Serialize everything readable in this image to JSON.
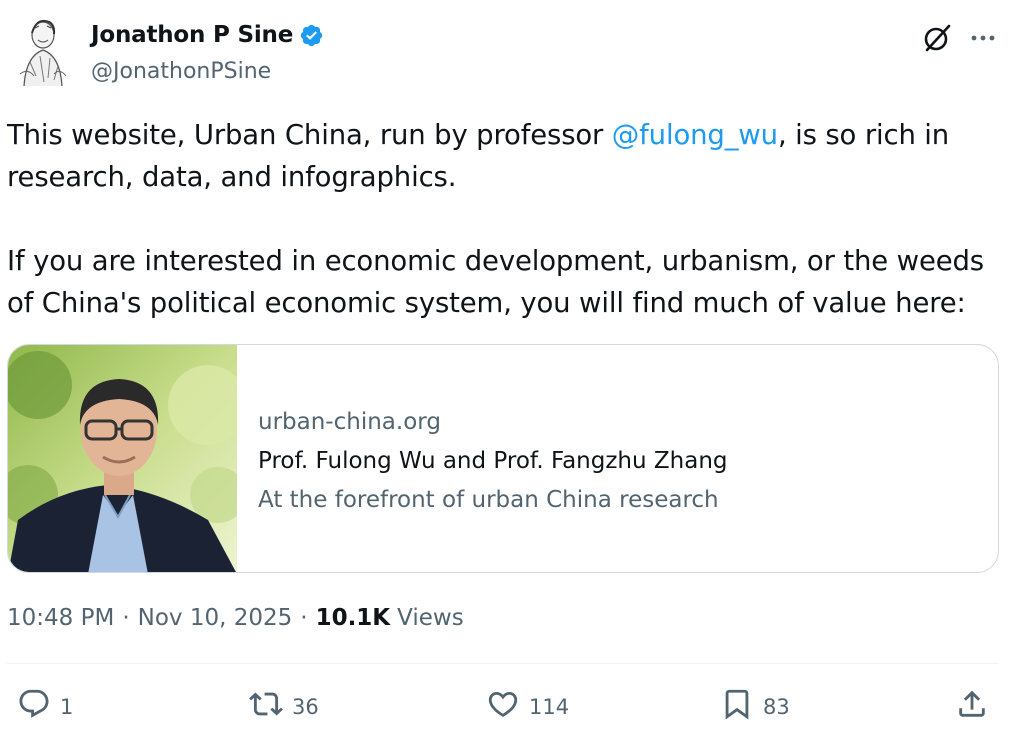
{
  "author": {
    "name": "Jonathon P Sine",
    "handle": "@JonathonPSine",
    "verified_icon": "verified-badge-icon",
    "avatar": "sketch-portrait-avatar"
  },
  "tweet": {
    "para1_before": "This website, Urban China, run by professor ",
    "mention": "@fulong_wu",
    "para1_after": ", is so rich in research, data, and infographics.",
    "para2": "If you are interested in economic development, urbanism, or the weeds of China's political economic system, you will find much of value here:"
  },
  "card": {
    "domain": "urban-china.org",
    "title": "Prof. Fulong Wu and Prof. Fangzhu Zhang",
    "description": "At the forefront of urban China research"
  },
  "meta": {
    "time": "10:48 PM",
    "separator": "·",
    "date": "Nov 10, 2025",
    "views_count": "10.1K",
    "views_label": "Views"
  },
  "actions": {
    "replies": "1",
    "reposts": "36",
    "likes": "114",
    "bookmarks": "83"
  },
  "colors": {
    "text": "#0f1419",
    "secondary": "#536471",
    "accent": "#1d9bf0",
    "border": "#cfd9de"
  }
}
